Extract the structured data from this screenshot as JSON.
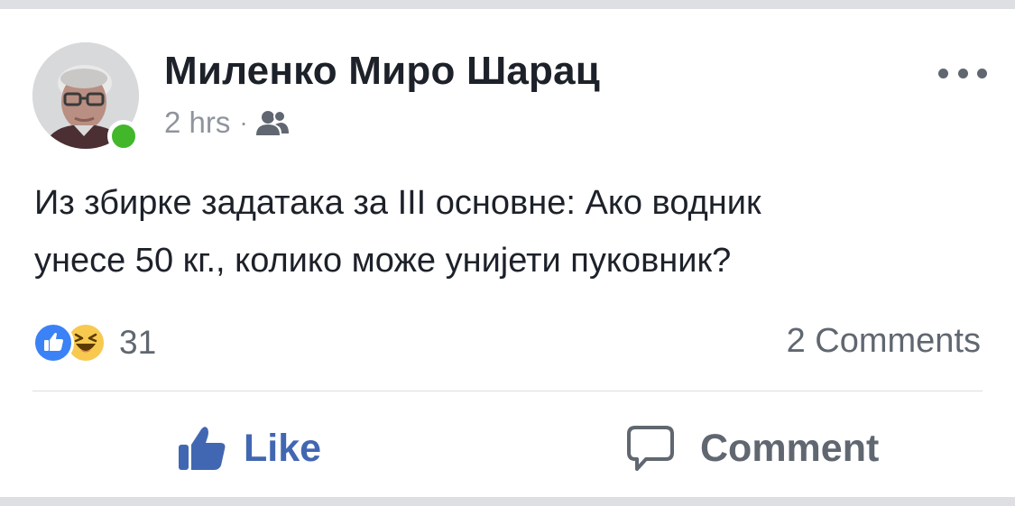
{
  "post": {
    "author": "Миленко Миро Шарац",
    "timestamp": "2 hrs",
    "separator": "·",
    "audience_icon": "friends-icon",
    "online_status_color": "#42b72a",
    "more_icon": "more-horizontal-icon",
    "text_line1": "Из збирке задатака за III основне: Ако водник",
    "text_line2": "унесе 50 кг., колико може унијети пуковник?"
  },
  "reactions": {
    "types": [
      "like",
      "haha"
    ],
    "count": "31"
  },
  "comments": {
    "label": "2 Comments"
  },
  "actions": {
    "like_label": "Like",
    "like_icon": "thumbs-up-icon",
    "like_color": "#4267b2",
    "comment_label": "Comment",
    "comment_icon": "speech-bubble-icon",
    "comment_color": "#606770"
  }
}
